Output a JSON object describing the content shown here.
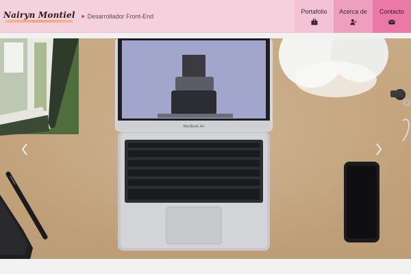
{
  "brand": {
    "name": "Nairyn Montiel",
    "tagline": "Desarrollador Front-End"
  },
  "nav": {
    "items": [
      {
        "label": "Portafolio",
        "icon": "briefcase-icon"
      },
      {
        "label": "Acerca de",
        "icon": "user-check-icon"
      },
      {
        "label": "Contacto",
        "icon": "envelope-icon"
      }
    ]
  },
  "carousel": {
    "prev_icon": "chevron-left-icon",
    "next_icon": "chevron-right-icon",
    "laptop_brand": "MacBook Air"
  },
  "colors": {
    "nav_bg": "#f4d1dd",
    "nav_item_1": "#f3c2d5",
    "nav_item_2": "#ef9fbe",
    "nav_item_3": "#ea7aa5",
    "accent": "#c64f78"
  }
}
